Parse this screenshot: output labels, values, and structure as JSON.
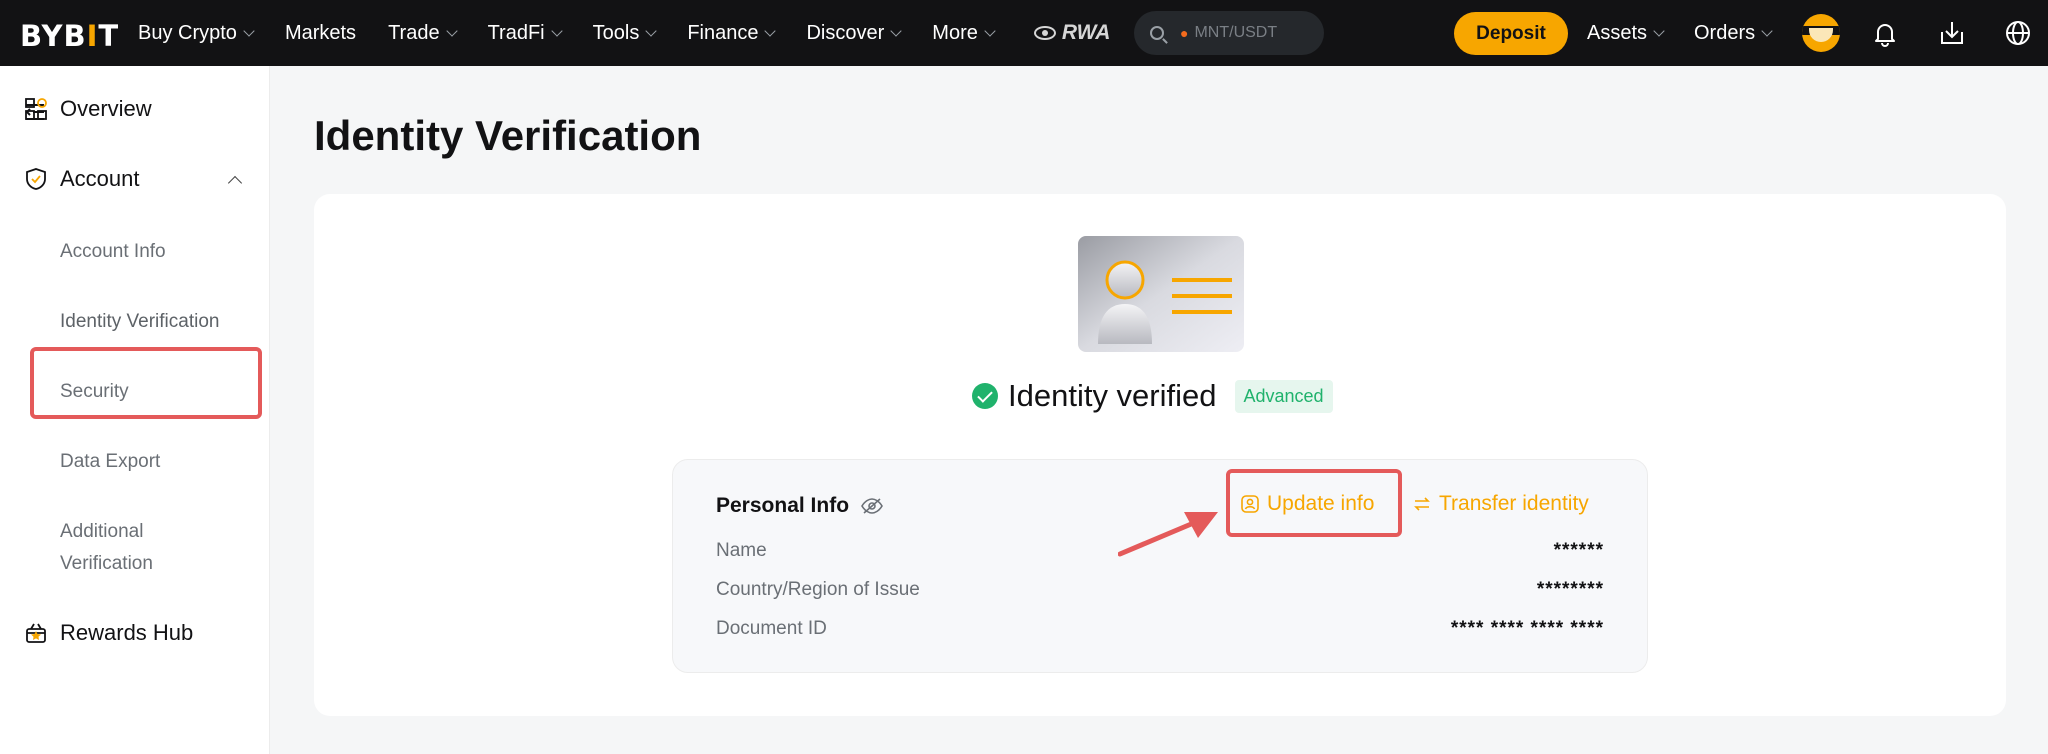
{
  "topbar": {
    "logo_left": "BYB",
    "logo_bar": "I",
    "logo_right": "T",
    "nav": [
      {
        "label": "Buy Crypto",
        "dropdown": true
      },
      {
        "label": "Markets",
        "dropdown": false
      },
      {
        "label": "Trade",
        "dropdown": true
      },
      {
        "label": "TradFi",
        "dropdown": true
      },
      {
        "label": "Tools",
        "dropdown": true
      },
      {
        "label": "Finance",
        "dropdown": true
      },
      {
        "label": "Discover",
        "dropdown": true
      },
      {
        "label": "More",
        "dropdown": true
      }
    ],
    "rwa_label": "RWA",
    "search_placeholder": "MNT/USDT",
    "deposit_label": "Deposit",
    "assets_label": "Assets",
    "orders_label": "Orders"
  },
  "sidebar": {
    "overview_label": "Overview",
    "account_label": "Account",
    "sub_items": [
      "Account Info",
      "Identity Verification",
      "Security",
      "Data Export",
      "Additional Verification"
    ],
    "rewards_label": "Rewards Hub"
  },
  "main": {
    "page_title": "Identity Verification",
    "status_text": "Identity verified",
    "level_badge": "Advanced",
    "personal_info_title": "Personal Info",
    "update_info_label": "Update info",
    "transfer_identity_label": "Transfer identity",
    "rows": [
      {
        "label": "Name",
        "value": "******"
      },
      {
        "label": "Country/Region of Issue",
        "value": "********"
      },
      {
        "label": "Document ID",
        "value": "**** **** **** ****"
      }
    ]
  },
  "colors": {
    "brand": "#f7a600",
    "topbar_bg": "#121214",
    "verified_green": "#20b26c",
    "highlight_red": "#e45a5a"
  },
  "icons": [
    "collapse-menu-icon",
    "overview-icon",
    "shield-icon",
    "gift-icon",
    "search-icon",
    "bell-icon",
    "download-icon",
    "globe-icon",
    "eye-off-icon",
    "profile-icon",
    "swap-icon",
    "check-circle-icon"
  ]
}
